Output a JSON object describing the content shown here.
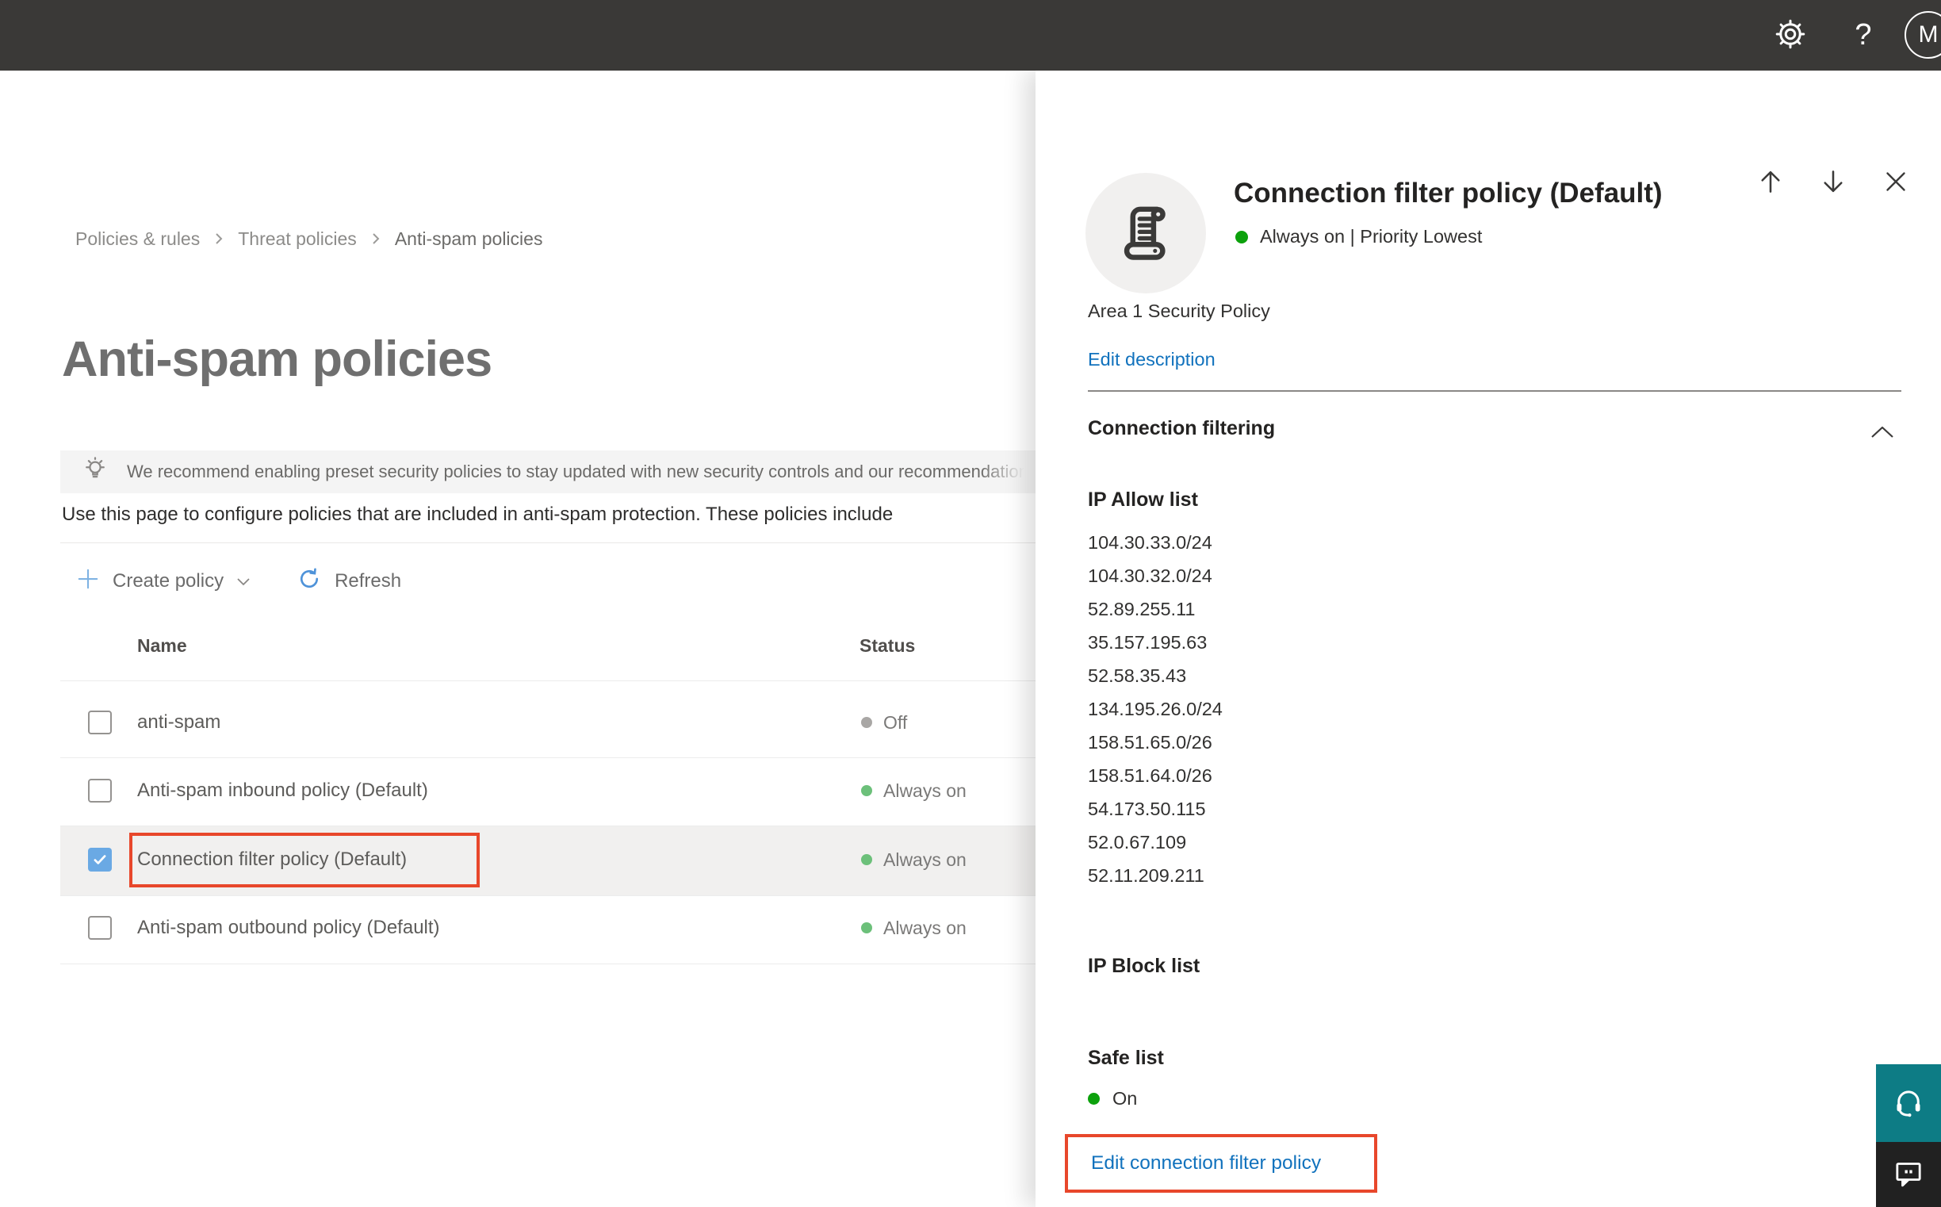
{
  "topbar": {
    "help_label": "?",
    "avatar_initial": "M"
  },
  "breadcrumb": {
    "items": [
      "Policies & rules",
      "Threat policies",
      "Anti-spam policies"
    ]
  },
  "page": {
    "title": "Anti-spam policies",
    "banner_text": "We recommend enabling preset security policies to stay updated with new security controls and our recommendations",
    "description": "Use this page to configure policies that are included in anti-spam protection. These policies include"
  },
  "toolbar": {
    "create_label": "Create policy",
    "refresh_label": "Refresh"
  },
  "table": {
    "columns": [
      "Name",
      "Status"
    ],
    "rows": [
      {
        "name": "anti-spam",
        "status": "Off",
        "state": "off",
        "checked": false,
        "highlighted": false
      },
      {
        "name": "Anti-spam inbound policy (Default)",
        "status": "Always on",
        "state": "on",
        "checked": false,
        "highlighted": false
      },
      {
        "name": "Connection filter policy (Default)",
        "status": "Always on",
        "state": "on",
        "checked": true,
        "highlighted": true
      },
      {
        "name": "Anti-spam outbound policy (Default)",
        "status": "Always on",
        "state": "on",
        "checked": false,
        "highlighted": false
      }
    ]
  },
  "panel": {
    "title": "Connection filter policy (Default)",
    "status_line": "Always on | Priority Lowest",
    "policy_group": "Area 1 Security Policy",
    "edit_description_label": "Edit description",
    "section_heading": "Connection filtering",
    "ip_allow": {
      "label": "IP Allow list",
      "items": [
        "104.30.33.0/24",
        "104.30.32.0/24",
        "52.89.255.11",
        "35.157.195.63",
        "52.58.35.43",
        "134.195.26.0/24",
        "158.51.65.0/26",
        "158.51.64.0/26",
        "54.173.50.115",
        "52.0.67.109",
        "52.11.209.211"
      ]
    },
    "ip_block_label": "IP Block list",
    "safe_list_label": "Safe list",
    "safe_list_value": "On",
    "edit_link_label": "Edit connection filter policy"
  },
  "icons": {
    "topbar": [
      "gear-icon",
      "help-icon",
      "avatar"
    ],
    "panel_nav": [
      "arrow-up-icon",
      "arrow-down-icon",
      "close-icon"
    ],
    "policy_icon": "scroll-icon",
    "banner_icon": "lightbulb-icon",
    "floating": [
      "headset-icon",
      "feedback-bubble-icon"
    ]
  },
  "colors": {
    "topbar_bg": "#3a3937",
    "accent_blue": "#1172bd",
    "toolbar_icon_blue": "#4f93d9",
    "highlight_red": "#e8472b",
    "checkbox_blue": "#6aa9e4",
    "status_on_green": "#6cc07a",
    "status_off_gray": "#a9a7a5",
    "panel_status_green": "#0ca10c",
    "help_teal": "#0d7c85",
    "feedback_dark": "#212121",
    "banner_bg": "#f4f4f4"
  }
}
